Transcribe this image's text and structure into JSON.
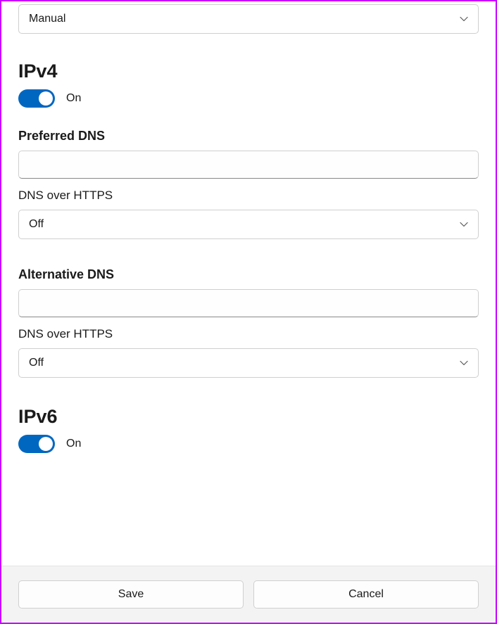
{
  "top_dropdown": {
    "value": "Manual"
  },
  "ipv4": {
    "heading": "IPv4",
    "toggle_state": "On",
    "preferred_dns_label": "Preferred DNS",
    "preferred_dns_value": "",
    "dns_over_https1_label": "DNS over HTTPS",
    "dns_over_https1_value": "Off",
    "alternative_dns_label": "Alternative DNS",
    "alternative_dns_value": "",
    "dns_over_https2_label": "DNS over HTTPS",
    "dns_over_https2_value": "Off"
  },
  "ipv6": {
    "heading": "IPv6",
    "toggle_state": "On"
  },
  "footer": {
    "save_label": "Save",
    "cancel_label": "Cancel"
  }
}
